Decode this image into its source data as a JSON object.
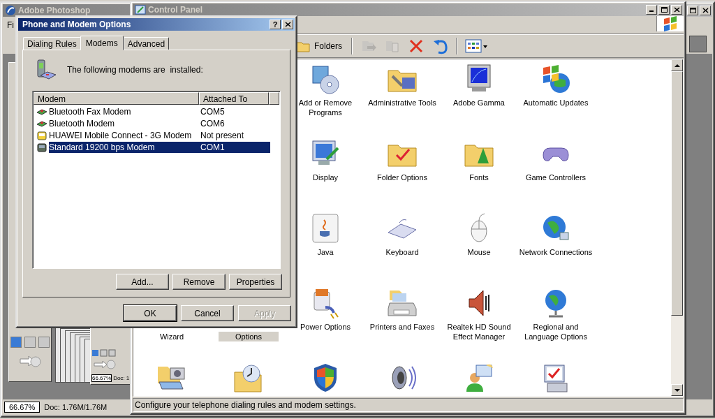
{
  "photoshop": {
    "title": "Adobe Photoshop",
    "active": false,
    "menu_fragment": "Fi",
    "zoom": "66.67%",
    "doc_info": "Doc: 1.76M/1.76M",
    "small_doc": {
      "zoom": "66.67%",
      "doc_info": "Doc: 1."
    }
  },
  "control_panel": {
    "title": "Control Panel",
    "active": false,
    "toolbar": {
      "folders": "Folders",
      "tools": [
        {
          "kind": "move",
          "disabled": true
        },
        {
          "kind": "copy",
          "disabled": true
        },
        {
          "kind": "delete",
          "disabled": false
        },
        {
          "kind": "undo",
          "disabled": false
        },
        {
          "kind": "views",
          "disabled": false
        }
      ]
    },
    "rows": [
      {
        "items": [
          {
            "kind": "programs",
            "label": "Add or Remove Programs",
            "selected": false
          },
          {
            "kind": "admin",
            "label": "Administrative Tools",
            "selected": false
          },
          {
            "kind": "gamma",
            "label": "Adobe Gamma",
            "selected": false
          },
          {
            "kind": "updates",
            "label": "Automatic Updates",
            "selected": false
          }
        ]
      },
      {
        "items": [
          {
            "kind": "display",
            "label": "Display",
            "selected": false
          },
          {
            "kind": "folder-options",
            "label": "Folder Options",
            "selected": false
          },
          {
            "kind": "fonts",
            "label": "Fonts",
            "selected": false
          },
          {
            "kind": "gamepad",
            "label": "Game Controllers",
            "selected": false
          }
        ]
      },
      {
        "items": [
          {
            "kind": "java",
            "label": "Java",
            "selected": false
          },
          {
            "kind": "keyboard",
            "label": "Keyboard",
            "selected": false
          },
          {
            "kind": "mouse",
            "label": "Mouse",
            "selected": false
          },
          {
            "kind": "network",
            "label": "Network Connections",
            "selected": false
          }
        ]
      },
      {
        "items": [
          {
            "label_tail": "Wizard",
            "selected": false
          },
          {
            "label_tail": "Options",
            "selected": true
          },
          {
            "kind": "power",
            "label": "Power Options",
            "selected": false
          },
          {
            "kind": "printers",
            "label": "Printers and Faxes",
            "selected": false
          },
          {
            "kind": "realtek",
            "label": "Realtek HD Sound Effect Manager",
            "selected": false
          },
          {
            "kind": "regional",
            "label": "Regional and Language Options",
            "selected": false
          }
        ]
      },
      {
        "items": [
          {
            "kind": "scanner",
            "selected": false
          },
          {
            "kind": "folder-clock",
            "selected": false
          },
          {
            "kind": "shield",
            "selected": false
          },
          {
            "kind": "speaker",
            "selected": false
          },
          {
            "kind": "users",
            "selected": false
          },
          {
            "kind": "computer-check",
            "selected": false
          }
        ]
      }
    ],
    "status_bar": "Configure your telephone dialing rules and modem settings."
  },
  "dialog": {
    "title": "Phone and Modem Options",
    "active": true,
    "help": "?",
    "tabs": [
      {
        "label": "Dialing Rules",
        "selected": false
      },
      {
        "label": "Modems",
        "selected": true
      },
      {
        "label": "Advanced",
        "selected": false
      }
    ],
    "intro": "The following modems are  installed:",
    "columns": [
      "Modem",
      "Attached To"
    ],
    "modems": [
      {
        "kind": "bluetooth",
        "name": "Bluetooth Fax Modem",
        "port": "COM5",
        "selected": false
      },
      {
        "kind": "bluetooth",
        "name": "Bluetooth Modem",
        "port": "COM6",
        "selected": false
      },
      {
        "kind": "huawei",
        "name": "HUAWEI Mobile Connect - 3G Modem",
        "port": "Not present",
        "selected": false
      },
      {
        "kind": "standard",
        "name": "Standard 19200 bps Modem",
        "port": "COM1",
        "selected": true
      }
    ],
    "list_buttons": [
      {
        "label": "Add...",
        "disabled": false
      },
      {
        "label": "Remove",
        "disabled": false
      },
      {
        "label": "Properties",
        "disabled": false
      }
    ],
    "buttons": [
      {
        "label": "OK",
        "default": true,
        "disabled": false
      },
      {
        "label": "Cancel",
        "default": false,
        "disabled": false
      },
      {
        "label": "Apply",
        "default": false,
        "disabled": true
      }
    ]
  }
}
